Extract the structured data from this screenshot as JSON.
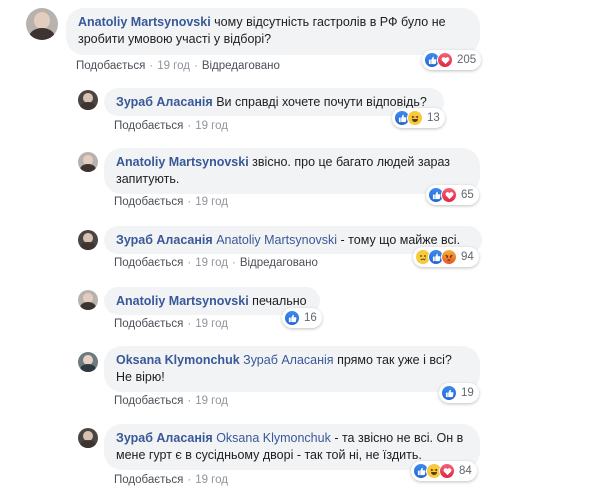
{
  "comments": [
    {
      "author": "Anatoliy Martsynovski",
      "mention": "",
      "text": "чому відсутність гастролів в РФ було не зробити умовою участі у відборі?",
      "actions": {
        "like": "Подобається",
        "time": "19 год",
        "edited": "Відредаговано"
      },
      "reactions": {
        "icons": [
          "like-icon",
          "love-icon"
        ],
        "count": "205"
      }
    },
    {
      "author": "Зураб Аласанія",
      "mention": "",
      "text": "Ви справді хочете почути відповідь?",
      "actions": {
        "like": "Подобається",
        "time": "19 год",
        "edited": ""
      },
      "reactions": {
        "icons": [
          "like-icon",
          "haha-icon"
        ],
        "count": "13"
      }
    },
    {
      "author": "Anatoliy Martsynovski",
      "mention": "",
      "text": "звісно. про це багато людей зараз запитують.",
      "actions": {
        "like": "Подобається",
        "time": "19 год",
        "edited": ""
      },
      "reactions": {
        "icons": [
          "like-icon",
          "love-icon"
        ],
        "count": "65"
      }
    },
    {
      "author": "Зураб Аласанія",
      "mention": "Anatoliy Martsynovski",
      "text": "- тому що майже всі.",
      "actions": {
        "like": "Подобається",
        "time": "19 год",
        "edited": "Відредаговано"
      },
      "reactions": {
        "icons": [
          "sad-icon",
          "like-icon",
          "angry-icon"
        ],
        "count": "94"
      }
    },
    {
      "author": "Anatoliy Martsynovski",
      "mention": "",
      "text": "печально",
      "actions": {
        "like": "Подобається",
        "time": "19 год",
        "edited": ""
      },
      "reactions": {
        "icons": [
          "like-icon"
        ],
        "count": "16"
      }
    },
    {
      "author": "Oksana Klymonchuk",
      "mention": "Зураб Аласанія",
      "text": "прямо так уже і всі? Не вірю!",
      "actions": {
        "like": "Подобається",
        "time": "19 год",
        "edited": ""
      },
      "reactions": {
        "icons": [
          "like-icon"
        ],
        "count": "19"
      }
    },
    {
      "author": "Зураб Аласанія",
      "mention": "Oksana Klymonchuk",
      "text": "- та звісно не всі. Он в мене гурт є в сусідньому дворі - так той ні, не їздить.",
      "actions": {
        "like": "Подобається",
        "time": "19 год",
        "edited": ""
      },
      "reactions": {
        "icons": [
          "like-icon",
          "haha-icon",
          "love-icon"
        ],
        "count": "84"
      }
    }
  ],
  "colors": {
    "author": "#385898",
    "bubble": "#f2f3f5",
    "meta": "#90949c",
    "like": "#2d6fe0",
    "love": "#e8344e",
    "emoji": "#f7c93b"
  }
}
